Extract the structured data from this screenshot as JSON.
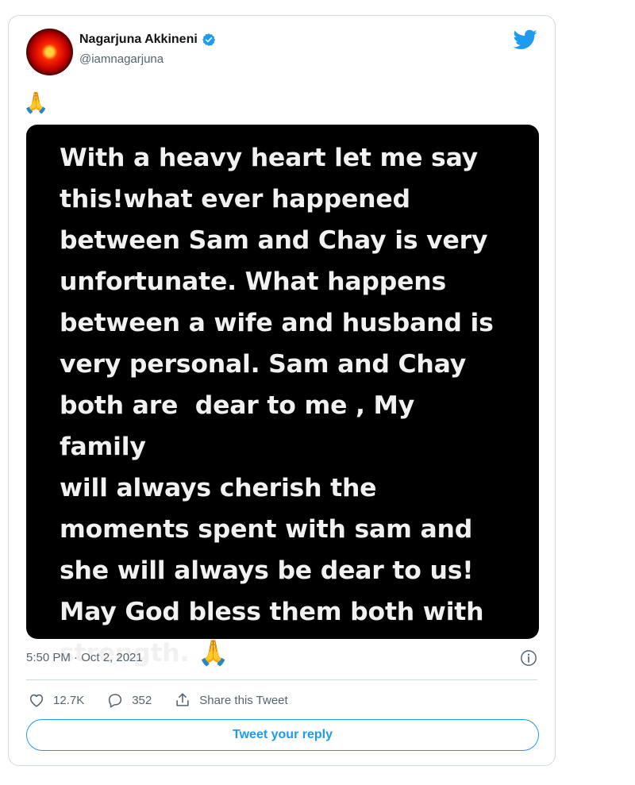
{
  "author": {
    "name": "Nagarjuna Akkineni",
    "handle": "@iamnagarjuna",
    "verified_color": "#1d9bf0"
  },
  "tweet": {
    "text_emoji": "🙏",
    "image_text": "With a heavy heart let me say\nthis!what ever happened\nbetween Sam and Chay is very\nunfortunate. What happens\nbetween a wife and husband is\nvery personal. Sam and Chay\nboth are  dear to me , My family\nwill always cherish the\nmoments spent with sam and\nshe will always be dear to us!\nMay God bless them both with\nstrength. 🙏",
    "timestamp": "5:50 PM · Oct 2, 2021"
  },
  "actions": {
    "likes": "12.7K",
    "replies": "352",
    "share_label": "Share this Tweet"
  },
  "reply": {
    "button_label": "Tweet your reply"
  },
  "icons": {
    "brand": "twitter-bird-icon",
    "verified": "verified-badge-icon",
    "info": "info-icon",
    "like": "heart-icon",
    "reply": "reply-bubble-icon",
    "share": "share-icon"
  },
  "colors": {
    "accent": "#1d9bf0",
    "secondary_text": "#536471",
    "border": "#cfd9de",
    "media_bg": "#000000"
  }
}
